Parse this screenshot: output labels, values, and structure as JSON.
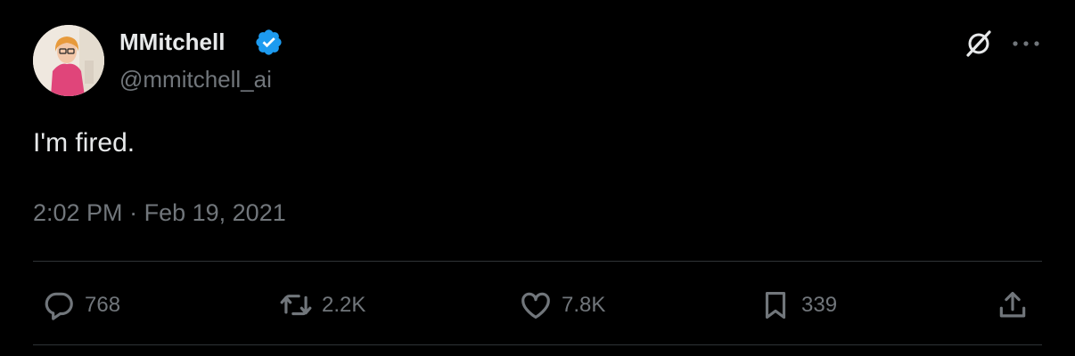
{
  "author": {
    "display_name": "MMitchell",
    "handle": "@mmitchell_ai",
    "verified": true
  },
  "tweet": {
    "text": "I'm fired.",
    "time": "2:02 PM",
    "separator": "·",
    "date": "Feb 19, 2021"
  },
  "actions": {
    "replies": "768",
    "reposts": "2.2K",
    "likes": "7.8K",
    "bookmarks": "339"
  },
  "icons": {
    "verified": "verified-badge-icon",
    "grok": "grok-icon",
    "more": "more-icon",
    "reply": "reply-icon",
    "repost": "repost-icon",
    "like": "heart-icon",
    "bookmark": "bookmark-icon",
    "share": "share-icon"
  },
  "colors": {
    "background": "#000000",
    "primary_text": "#e7e9ea",
    "secondary_text": "#71767b",
    "verified_blue": "#1d9bf0",
    "divider": "#2f3336"
  }
}
